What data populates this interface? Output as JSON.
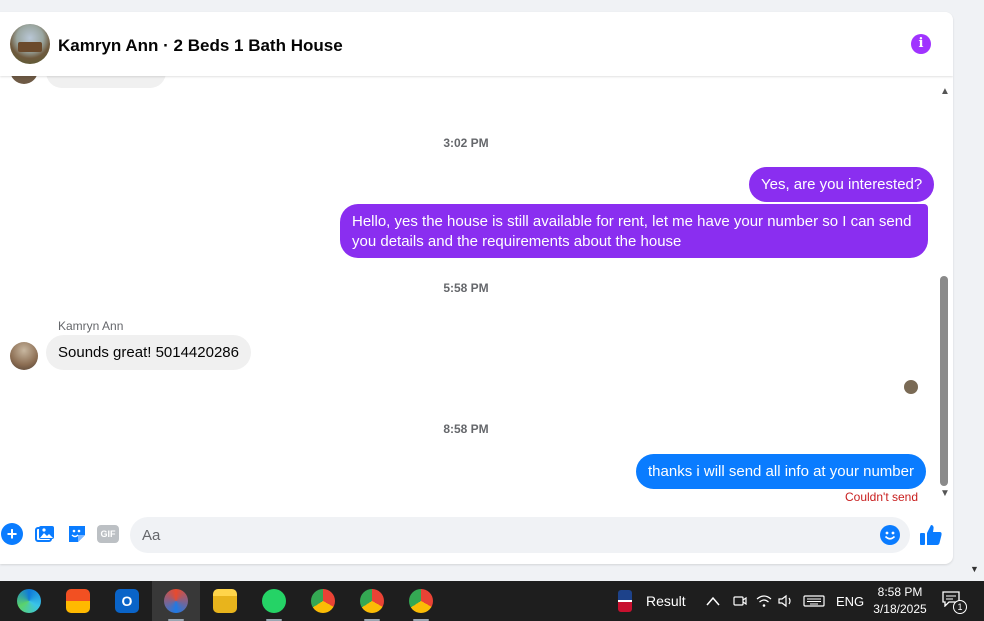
{
  "header": {
    "title": "Kamryn Ann · 2 Beds 1 Bath House"
  },
  "messages": {
    "timestamps": [
      "3:02 PM",
      "5:58 PM",
      "8:58 PM"
    ],
    "outgoing_1": "Yes, are you interested?",
    "outgoing_2": "Hello, yes the house is still available for rent, let me have your number so I can send you details and the requirements about the house",
    "incoming_sender": "Kamryn Ann",
    "incoming_1": "Sounds great! 5014420286",
    "outgoing_3": "thanks i will send all info at your number",
    "error": "Couldn't send"
  },
  "composer": {
    "placeholder": "Aa",
    "gif_label": "GIF"
  },
  "taskbar": {
    "widget_label": "Result",
    "language": "ENG",
    "time": "8:58 PM",
    "date": "3/18/2025",
    "notification_count": "1"
  },
  "colors": {
    "accent_purple": "#8a2ef0",
    "accent_blue": "#0a7cff",
    "error_red": "#c81e1e"
  }
}
